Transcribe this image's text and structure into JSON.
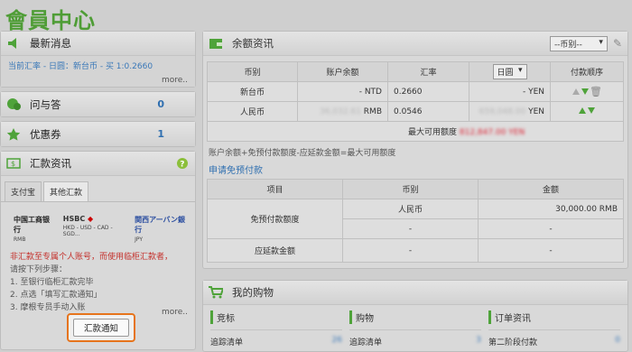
{
  "page_title": "會員中心",
  "left": {
    "news": {
      "title": "最新消息",
      "line": "当前汇率 - 日圆：新台币 - 买 1:0.2660",
      "more": "more.."
    },
    "qa": {
      "title": "问与答",
      "count": "0"
    },
    "coupon": {
      "title": "优惠券",
      "count": "1"
    },
    "remit": {
      "title": "汇款资讯",
      "tabs": [
        "支付宝",
        "其他汇款"
      ],
      "logos": [
        {
          "name": "中国工商银行",
          "sub": "RMB"
        },
        {
          "name": "HSBC",
          "sub": "HKD - USD - CAD - SGD..."
        },
        {
          "name": "関西アーバン銀行",
          "sub": "JPY"
        }
      ],
      "warning": "非汇款至专属个人账号，而使用临柜汇款者，",
      "steps_title": "请按下列步骤：",
      "steps": [
        "1. 至银行临柜汇款完毕",
        "2. 点选「填写汇款通知」",
        "3. 摩根专员手动入账"
      ],
      "more": "more..",
      "button": "汇款通知"
    }
  },
  "balance": {
    "title": "余额资讯",
    "currency_select": "--币别--",
    "headers": [
      "币别",
      "账户余额",
      "汇率",
      "日圆",
      "付款顺序"
    ],
    "rows": [
      {
        "currency": "新台币",
        "balance": "-",
        "unit": "NTD",
        "rate": "0.2660",
        "jpy": "-",
        "jpy_unit": "YEN"
      },
      {
        "currency": "人民币",
        "balance": "36,032.61",
        "unit": "RMB",
        "rate": "0.0546",
        "jpy": "659,048.00",
        "jpy_unit": "YEN"
      }
    ],
    "max_label": "最大可用额度",
    "max_value": "812,847.00 YEN",
    "formula": "账户余额+免预付款额度-应延款金额=最大可用额度",
    "apply_link": "申请免预付款",
    "credit_headers": [
      "项目",
      "币别",
      "金额"
    ],
    "credit_label": "免预付款额度",
    "credit_rows": [
      {
        "currency": "人民币",
        "amount": "30,000.00 RMB"
      },
      {
        "currency": "-",
        "amount": "-"
      }
    ],
    "deferred_label": "应延款金额",
    "deferred_row": {
      "currency": "-",
      "amount": "-"
    }
  },
  "cart": {
    "title": "我的购物",
    "cols": [
      {
        "head": "竞标",
        "label": "追踪清单",
        "value": "26"
      },
      {
        "head": "购物",
        "label": "追踪清单",
        "value": "3"
      },
      {
        "head": "订单资讯",
        "label": "第二阶段付款",
        "value": "0"
      }
    ]
  }
}
